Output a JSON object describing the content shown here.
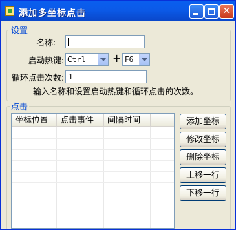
{
  "window": {
    "title": "添加多坐标点击",
    "close_glyph": "✕"
  },
  "settings": {
    "legend": "设置",
    "name_label": "名称:",
    "name_value": "",
    "hotkey_label": "启动热键:",
    "modifier_value": "Ctrl",
    "plus": "+",
    "key_value": "F6",
    "loop_label": "循环点击次数:",
    "loop_value": "1",
    "hint": "输入名称和设置启动热键和循环点击的次数。"
  },
  "click": {
    "legend": "点击",
    "columns": [
      "坐标位置",
      "点击事件",
      "间隔时间"
    ],
    "rows": []
  },
  "buttons": {
    "add": "添加坐标",
    "edit": "修改坐标",
    "delete": "删除坐标",
    "up": "上移一行",
    "down": "下移一行"
  },
  "colors": {
    "titlebar": "#0A5FEF",
    "legend_text": "#0046D5",
    "window_bg": "#ECE9D8"
  }
}
